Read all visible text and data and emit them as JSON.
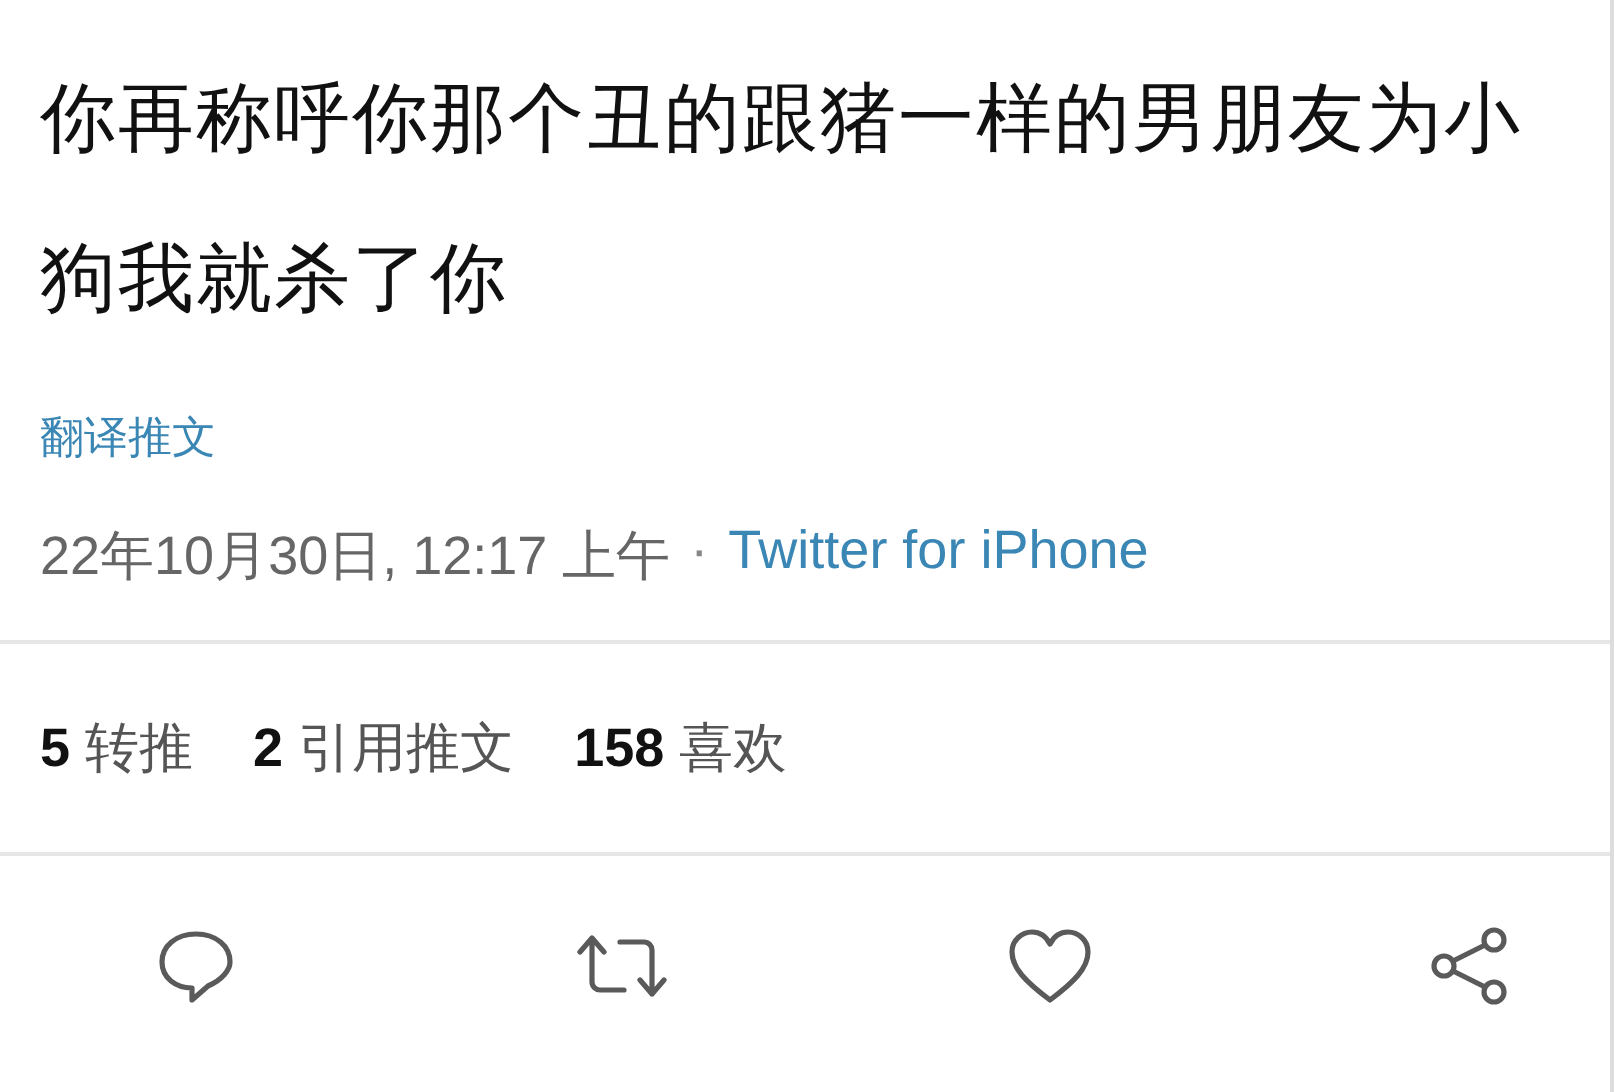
{
  "tweet": {
    "text": "你再称呼你那个丑的跟猪一样的男朋友为小狗我就杀了你",
    "translate_link": "翻译推文",
    "timestamp": "22年10月30日, 12:17 上午",
    "separator": "·",
    "source": "Twitter for iPhone"
  },
  "stats": [
    {
      "count": "5",
      "label": "转推"
    },
    {
      "count": "2",
      "label": "引用推文"
    },
    {
      "count": "158",
      "label": "喜欢"
    }
  ],
  "actions": [
    {
      "kind": "reply"
    },
    {
      "kind": "retweet"
    },
    {
      "kind": "like"
    },
    {
      "kind": "share"
    }
  ]
}
